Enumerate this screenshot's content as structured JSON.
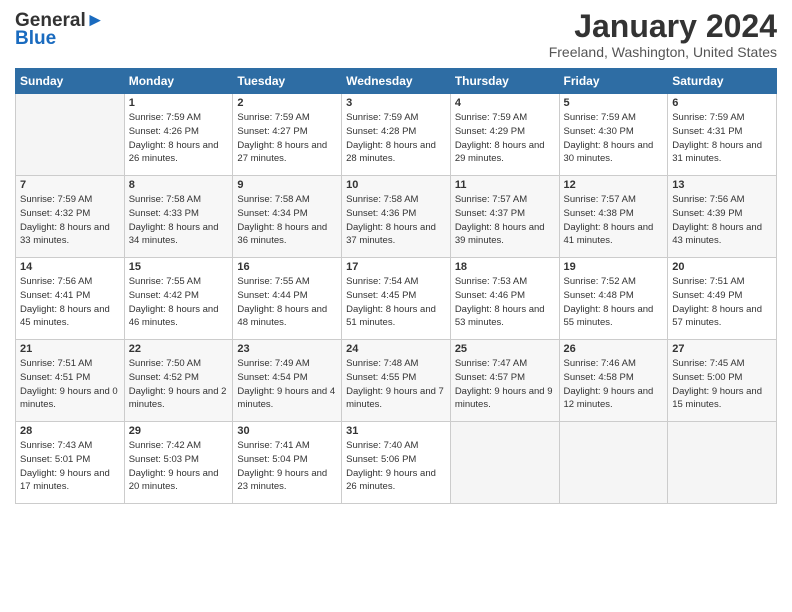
{
  "header": {
    "logo_general": "General",
    "logo_blue": "Blue",
    "month_title": "January 2024",
    "location": "Freeland, Washington, United States"
  },
  "days_of_week": [
    "Sunday",
    "Monday",
    "Tuesday",
    "Wednesday",
    "Thursday",
    "Friday",
    "Saturday"
  ],
  "weeks": [
    [
      {
        "day": "",
        "sunrise": "",
        "sunset": "",
        "daylight": "",
        "empty": true
      },
      {
        "day": "1",
        "sunrise": "Sunrise: 7:59 AM",
        "sunset": "Sunset: 4:26 PM",
        "daylight": "Daylight: 8 hours and 26 minutes."
      },
      {
        "day": "2",
        "sunrise": "Sunrise: 7:59 AM",
        "sunset": "Sunset: 4:27 PM",
        "daylight": "Daylight: 8 hours and 27 minutes."
      },
      {
        "day": "3",
        "sunrise": "Sunrise: 7:59 AM",
        "sunset": "Sunset: 4:28 PM",
        "daylight": "Daylight: 8 hours and 28 minutes."
      },
      {
        "day": "4",
        "sunrise": "Sunrise: 7:59 AM",
        "sunset": "Sunset: 4:29 PM",
        "daylight": "Daylight: 8 hours and 29 minutes."
      },
      {
        "day": "5",
        "sunrise": "Sunrise: 7:59 AM",
        "sunset": "Sunset: 4:30 PM",
        "daylight": "Daylight: 8 hours and 30 minutes."
      },
      {
        "day": "6",
        "sunrise": "Sunrise: 7:59 AM",
        "sunset": "Sunset: 4:31 PM",
        "daylight": "Daylight: 8 hours and 31 minutes."
      }
    ],
    [
      {
        "day": "7",
        "sunrise": "Sunrise: 7:59 AM",
        "sunset": "Sunset: 4:32 PM",
        "daylight": "Daylight: 8 hours and 33 minutes."
      },
      {
        "day": "8",
        "sunrise": "Sunrise: 7:58 AM",
        "sunset": "Sunset: 4:33 PM",
        "daylight": "Daylight: 8 hours and 34 minutes."
      },
      {
        "day": "9",
        "sunrise": "Sunrise: 7:58 AM",
        "sunset": "Sunset: 4:34 PM",
        "daylight": "Daylight: 8 hours and 36 minutes."
      },
      {
        "day": "10",
        "sunrise": "Sunrise: 7:58 AM",
        "sunset": "Sunset: 4:36 PM",
        "daylight": "Daylight: 8 hours and 37 minutes."
      },
      {
        "day": "11",
        "sunrise": "Sunrise: 7:57 AM",
        "sunset": "Sunset: 4:37 PM",
        "daylight": "Daylight: 8 hours and 39 minutes."
      },
      {
        "day": "12",
        "sunrise": "Sunrise: 7:57 AM",
        "sunset": "Sunset: 4:38 PM",
        "daylight": "Daylight: 8 hours and 41 minutes."
      },
      {
        "day": "13",
        "sunrise": "Sunrise: 7:56 AM",
        "sunset": "Sunset: 4:39 PM",
        "daylight": "Daylight: 8 hours and 43 minutes."
      }
    ],
    [
      {
        "day": "14",
        "sunrise": "Sunrise: 7:56 AM",
        "sunset": "Sunset: 4:41 PM",
        "daylight": "Daylight: 8 hours and 45 minutes."
      },
      {
        "day": "15",
        "sunrise": "Sunrise: 7:55 AM",
        "sunset": "Sunset: 4:42 PM",
        "daylight": "Daylight: 8 hours and 46 minutes."
      },
      {
        "day": "16",
        "sunrise": "Sunrise: 7:55 AM",
        "sunset": "Sunset: 4:44 PM",
        "daylight": "Daylight: 8 hours and 48 minutes."
      },
      {
        "day": "17",
        "sunrise": "Sunrise: 7:54 AM",
        "sunset": "Sunset: 4:45 PM",
        "daylight": "Daylight: 8 hours and 51 minutes."
      },
      {
        "day": "18",
        "sunrise": "Sunrise: 7:53 AM",
        "sunset": "Sunset: 4:46 PM",
        "daylight": "Daylight: 8 hours and 53 minutes."
      },
      {
        "day": "19",
        "sunrise": "Sunrise: 7:52 AM",
        "sunset": "Sunset: 4:48 PM",
        "daylight": "Daylight: 8 hours and 55 minutes."
      },
      {
        "day": "20",
        "sunrise": "Sunrise: 7:51 AM",
        "sunset": "Sunset: 4:49 PM",
        "daylight": "Daylight: 8 hours and 57 minutes."
      }
    ],
    [
      {
        "day": "21",
        "sunrise": "Sunrise: 7:51 AM",
        "sunset": "Sunset: 4:51 PM",
        "daylight": "Daylight: 9 hours and 0 minutes."
      },
      {
        "day": "22",
        "sunrise": "Sunrise: 7:50 AM",
        "sunset": "Sunset: 4:52 PM",
        "daylight": "Daylight: 9 hours and 2 minutes."
      },
      {
        "day": "23",
        "sunrise": "Sunrise: 7:49 AM",
        "sunset": "Sunset: 4:54 PM",
        "daylight": "Daylight: 9 hours and 4 minutes."
      },
      {
        "day": "24",
        "sunrise": "Sunrise: 7:48 AM",
        "sunset": "Sunset: 4:55 PM",
        "daylight": "Daylight: 9 hours and 7 minutes."
      },
      {
        "day": "25",
        "sunrise": "Sunrise: 7:47 AM",
        "sunset": "Sunset: 4:57 PM",
        "daylight": "Daylight: 9 hours and 9 minutes."
      },
      {
        "day": "26",
        "sunrise": "Sunrise: 7:46 AM",
        "sunset": "Sunset: 4:58 PM",
        "daylight": "Daylight: 9 hours and 12 minutes."
      },
      {
        "day": "27",
        "sunrise": "Sunrise: 7:45 AM",
        "sunset": "Sunset: 5:00 PM",
        "daylight": "Daylight: 9 hours and 15 minutes."
      }
    ],
    [
      {
        "day": "28",
        "sunrise": "Sunrise: 7:43 AM",
        "sunset": "Sunset: 5:01 PM",
        "daylight": "Daylight: 9 hours and 17 minutes."
      },
      {
        "day": "29",
        "sunrise": "Sunrise: 7:42 AM",
        "sunset": "Sunset: 5:03 PM",
        "daylight": "Daylight: 9 hours and 20 minutes."
      },
      {
        "day": "30",
        "sunrise": "Sunrise: 7:41 AM",
        "sunset": "Sunset: 5:04 PM",
        "daylight": "Daylight: 9 hours and 23 minutes."
      },
      {
        "day": "31",
        "sunrise": "Sunrise: 7:40 AM",
        "sunset": "Sunset: 5:06 PM",
        "daylight": "Daylight: 9 hours and 26 minutes."
      },
      {
        "day": "",
        "sunrise": "",
        "sunset": "",
        "daylight": "",
        "empty": true
      },
      {
        "day": "",
        "sunrise": "",
        "sunset": "",
        "daylight": "",
        "empty": true
      },
      {
        "day": "",
        "sunrise": "",
        "sunset": "",
        "daylight": "",
        "empty": true
      }
    ]
  ]
}
